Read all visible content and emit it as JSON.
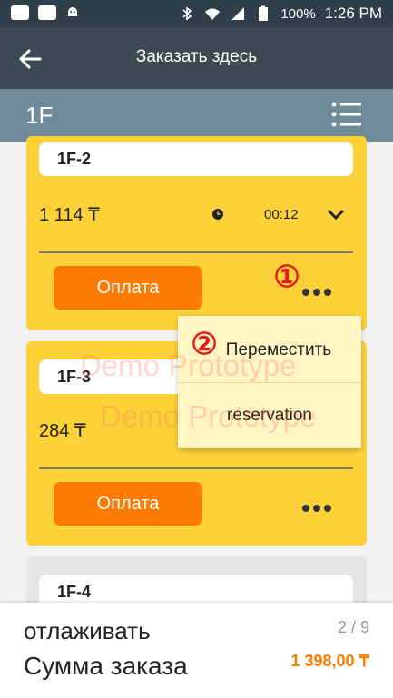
{
  "status_bar": {
    "battery": "100%",
    "time": "1:26 PM"
  },
  "header": {
    "title": "Заказать здесь"
  },
  "floor": {
    "name": "1F"
  },
  "tables": [
    {
      "name": "1F-2",
      "amount": "1 114 ₸",
      "timer": "00:12",
      "pay_label": "Оплата",
      "marker": "①"
    },
    {
      "name": "1F-3",
      "amount": "284 ₸",
      "pay_label": "Оплата"
    },
    {
      "name": "1F-4"
    }
  ],
  "popup": {
    "marker": "②",
    "items": [
      "Переместить",
      "reservation"
    ]
  },
  "watermarks": [
    "Demo Prototype",
    "Demo Prototype"
  ],
  "footer": {
    "debug_label": "отлаживать",
    "page": "2 / 9",
    "sum_label": "Сумма заказа",
    "sum_value": "1 398,00 ₸"
  },
  "colors": {
    "accent": "#ff7a00",
    "card": "#fdd238",
    "header": "#3d4a54",
    "floor_bar": "#6f8a98"
  }
}
